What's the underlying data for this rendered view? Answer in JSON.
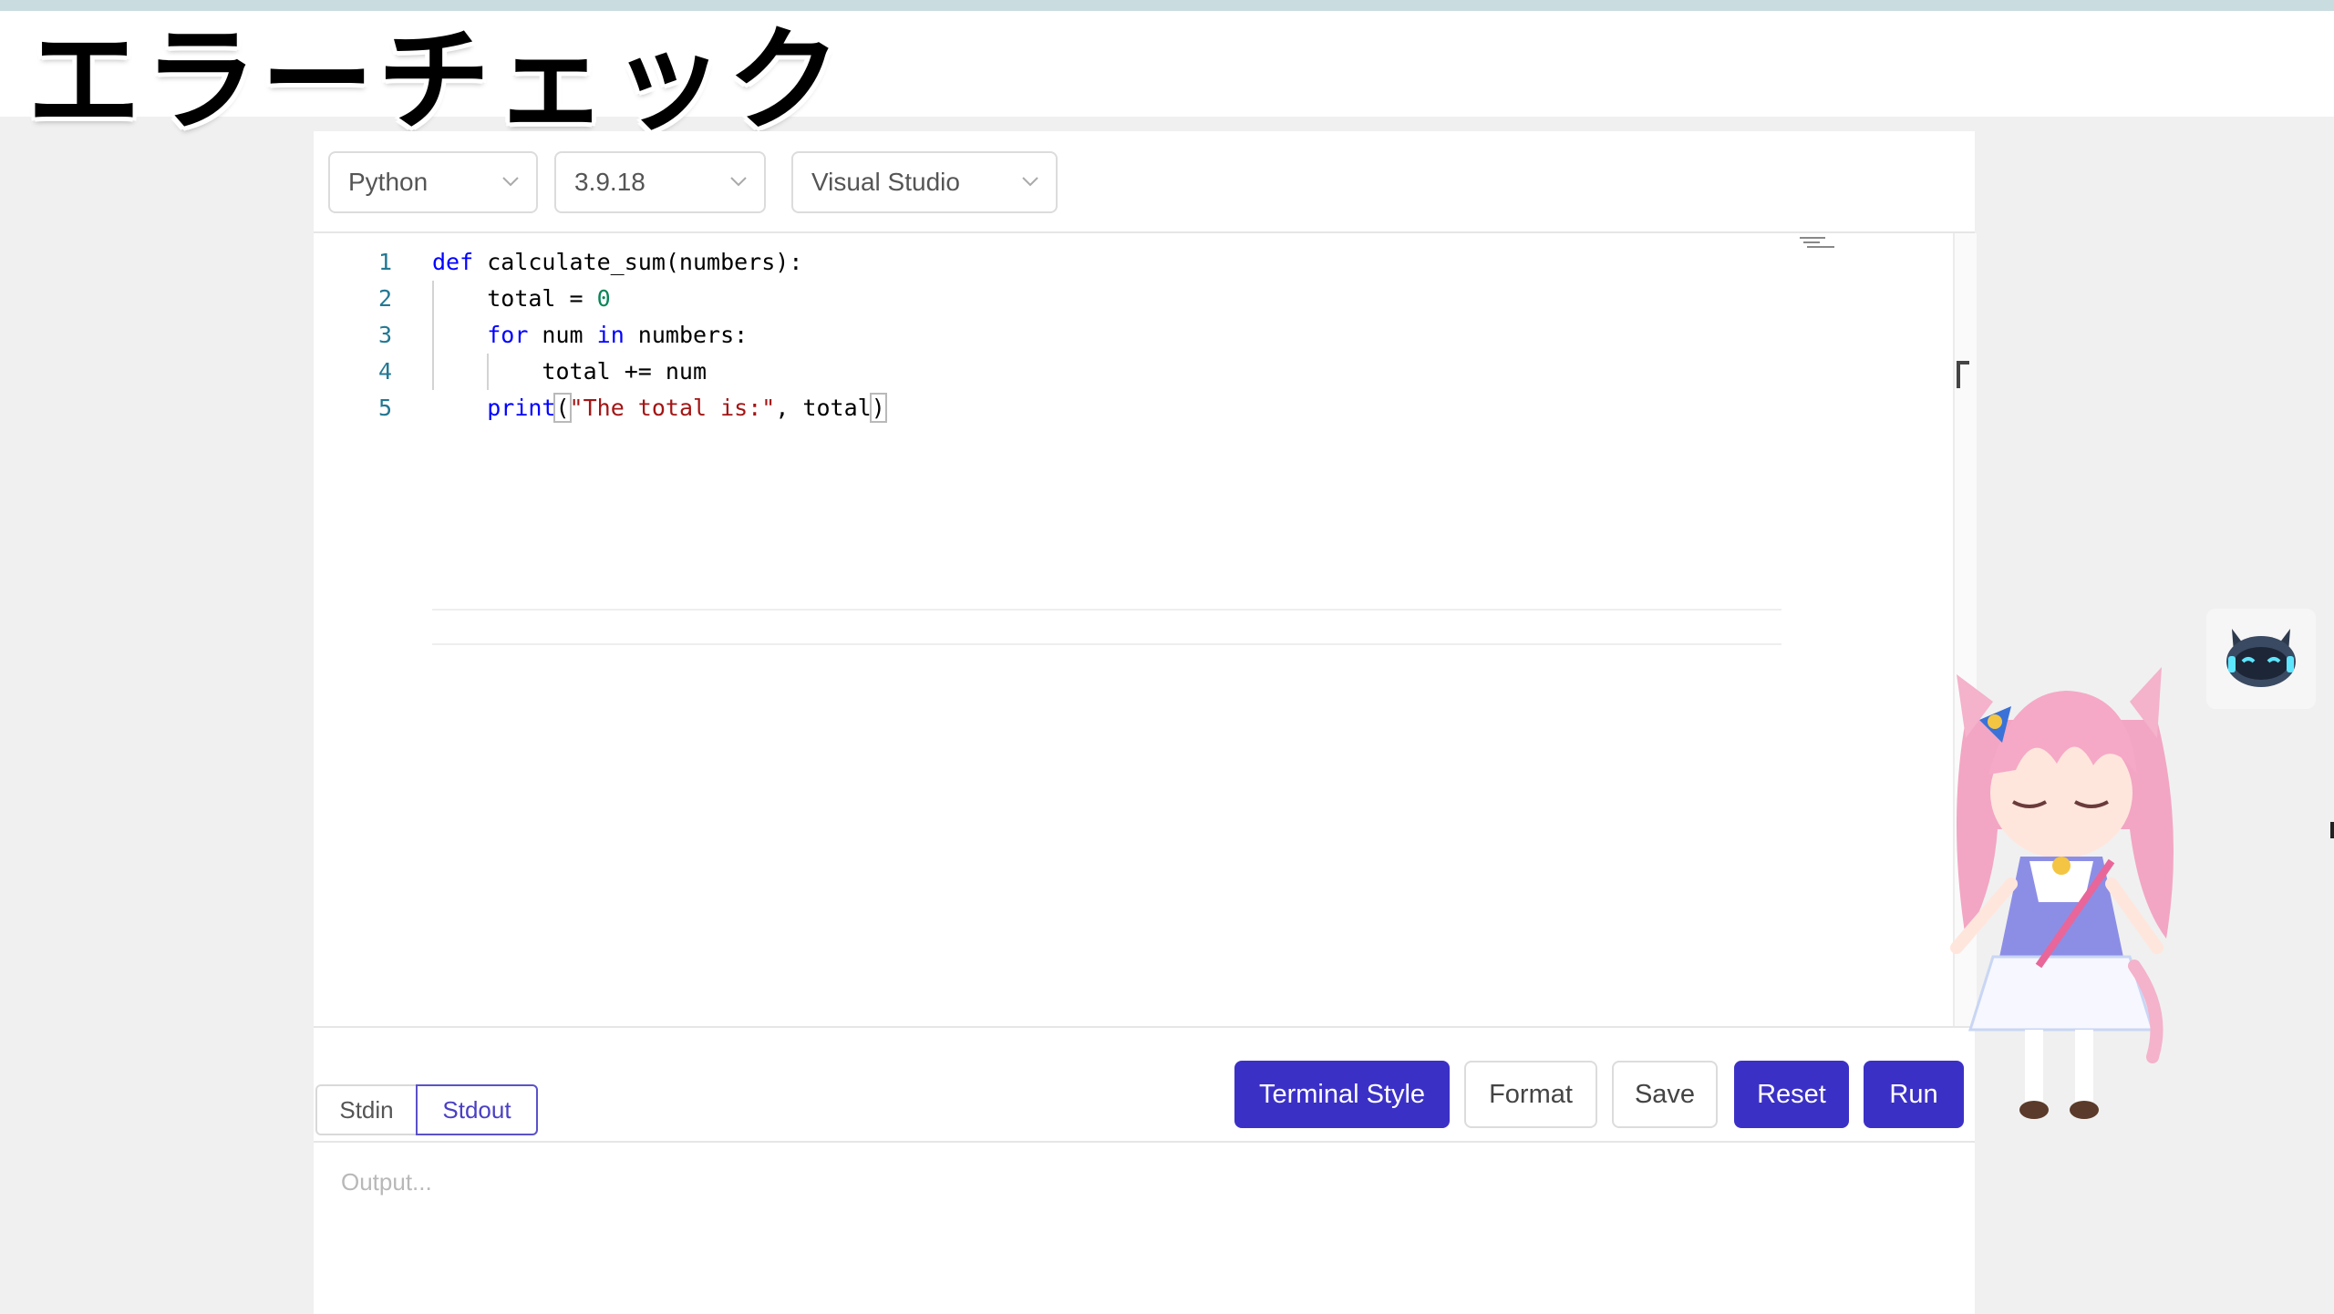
{
  "title": "エラーチェック",
  "selects": {
    "language": "Python",
    "version": "3.9.18",
    "theme": "Visual Studio"
  },
  "editor": {
    "line_numbers": [
      "1",
      "2",
      "3",
      "4",
      "5"
    ],
    "lines": [
      {
        "indent": "",
        "tokens": [
          {
            "t": "def",
            "c": "kw"
          },
          {
            "t": " calculate_sum(numbers):",
            "c": ""
          }
        ]
      },
      {
        "indent": "    ",
        "tokens": [
          {
            "t": "total = ",
            "c": ""
          },
          {
            "t": "0",
            "c": "num"
          }
        ]
      },
      {
        "indent": "    ",
        "tokens": [
          {
            "t": "for",
            "c": "kw"
          },
          {
            "t": " num ",
            "c": ""
          },
          {
            "t": "in",
            "c": "kw"
          },
          {
            "t": " numbers:",
            "c": ""
          }
        ]
      },
      {
        "indent": "        ",
        "tokens": [
          {
            "t": "total += num",
            "c": ""
          }
        ]
      },
      {
        "indent": "    ",
        "tokens": [
          {
            "t": "print",
            "c": "kw"
          },
          {
            "t": "(",
            "c": "bracket"
          },
          {
            "t": "\"The total is:\"",
            "c": "str"
          },
          {
            "t": ", total",
            "c": ""
          },
          {
            "t": ")",
            "c": "bracket"
          }
        ]
      }
    ]
  },
  "tabs": {
    "stdin": "Stdin",
    "stdout": "Stdout",
    "active": "stdout"
  },
  "buttons": {
    "terminal_style": "Terminal Style",
    "format": "Format",
    "save": "Save",
    "reset": "Reset",
    "run": "Run"
  },
  "output": {
    "placeholder": "Output..."
  },
  "icons": {
    "dropdown": "chevron-down-icon",
    "assistant": "robot-icon",
    "mascot": "anime-catgirl-character"
  },
  "colors": {
    "primary_button": "#3b30c6",
    "active_tab_border": "#5b52c8",
    "keyword": "#0000ff",
    "string": "#a31515",
    "number": "#098658",
    "line_number": "#237893"
  }
}
